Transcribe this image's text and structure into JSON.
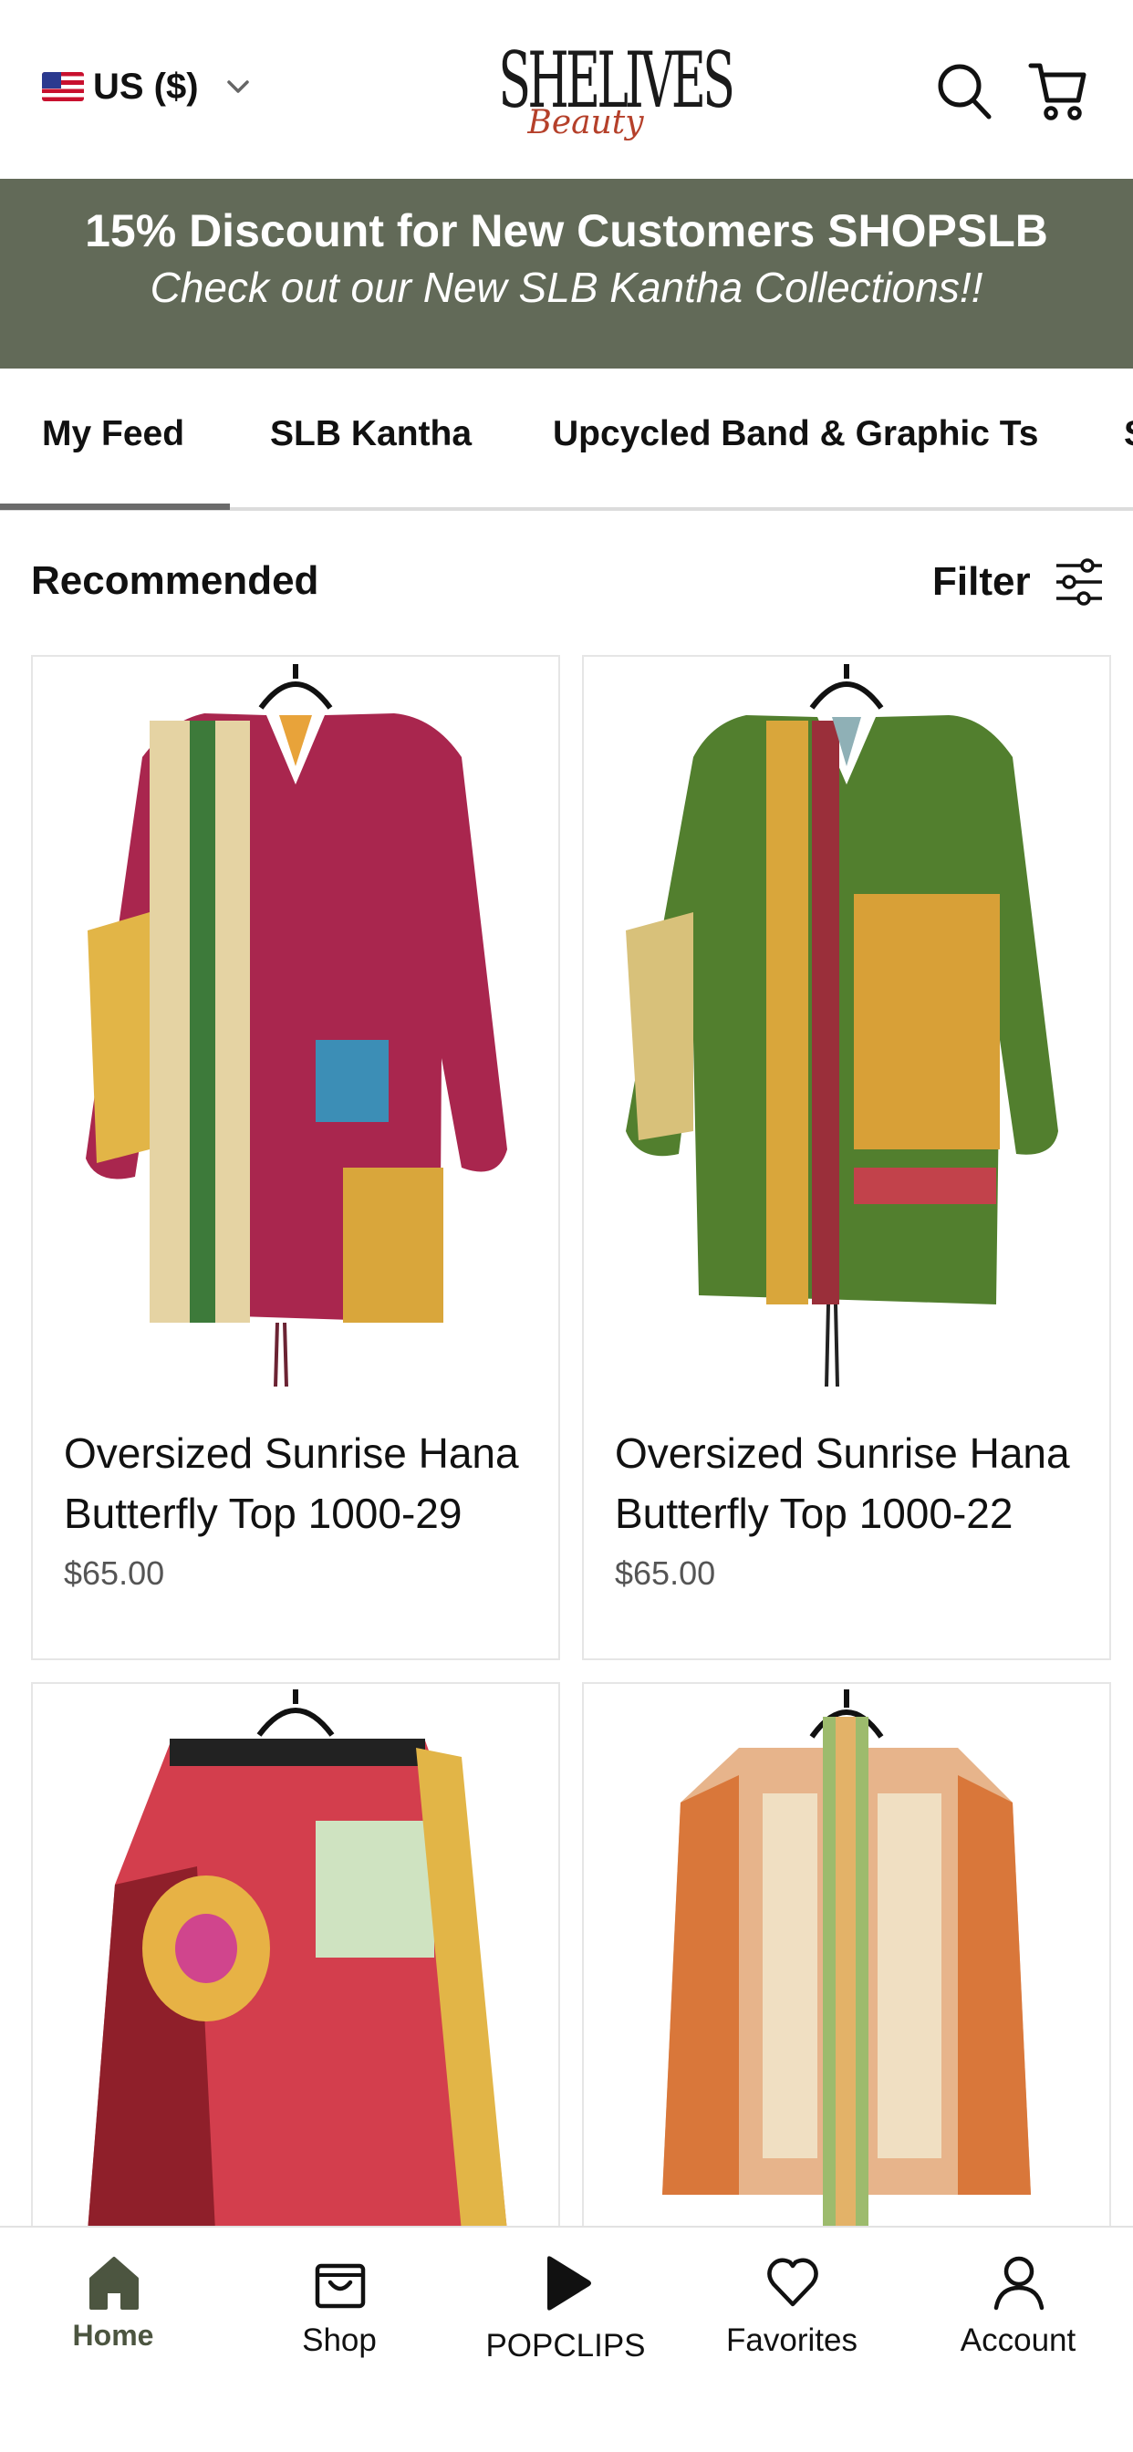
{
  "header": {
    "currency_label": "US ($)",
    "logo_main": "SHELIVES",
    "logo_sub": "Beauty",
    "icons": [
      "us-flag-icon",
      "chevron-down-icon",
      "search-icon",
      "cart-icon"
    ]
  },
  "banner": {
    "title": "15% Discount for New Customers SHOPSLB",
    "subtitle": "Check out our New SLB Kantha Collections!!",
    "background": "#626a58"
  },
  "tabs": [
    {
      "label": "My Feed",
      "active": true
    },
    {
      "label": "SLB Kantha",
      "active": false
    },
    {
      "label": "Upcycled Band & Graphic Ts",
      "active": false
    },
    {
      "label": "S",
      "active": false
    }
  ],
  "section": {
    "title": "Recommended",
    "filter_label": "Filter"
  },
  "products": [
    {
      "name_line1": "Oversized Sunrise Hana",
      "name_line2": "Butterfly Top 1000-29",
      "price": "$65.00"
    },
    {
      "name_line1": "Oversized Sunrise Hana",
      "name_line2": "Butterfly Top 1000-22",
      "price": "$65.00"
    },
    {
      "name_line1": "",
      "name_line2": "",
      "price": ""
    },
    {
      "name_line1": "",
      "name_line2": "",
      "price": ""
    }
  ],
  "bottom_nav": [
    {
      "label": "Home",
      "icon": "home-icon",
      "active": true
    },
    {
      "label": "Shop",
      "icon": "shop-bag-icon",
      "active": false
    },
    {
      "label": "POPCLIPS",
      "icon": "play-icon",
      "active": false
    },
    {
      "label": "Favorites",
      "icon": "heart-icon",
      "active": false
    },
    {
      "label": "Account",
      "icon": "person-icon",
      "active": false
    }
  ],
  "colors": {
    "accent": "#626a58",
    "home_active": "#4c5540",
    "logo_accent": "#b5402a"
  }
}
